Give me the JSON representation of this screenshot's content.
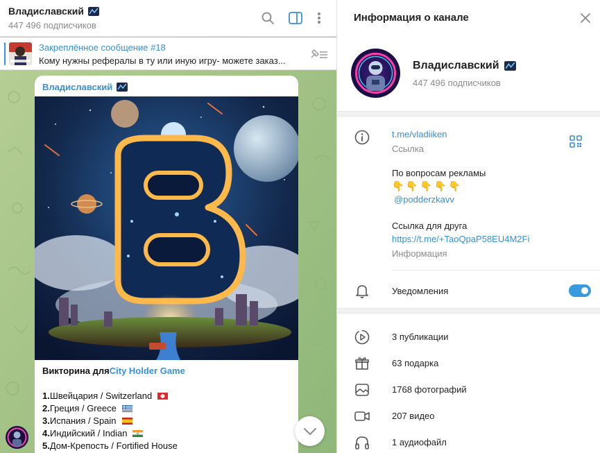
{
  "chat": {
    "title": "Владиславский",
    "subtitle": "447 496 подписчиков",
    "pinned": {
      "title": "Закреплённое сообщение #18",
      "text": "Кому нужны рефералы в ту или иную игру- можете заказ..."
    },
    "message": {
      "author": "Владиславский",
      "quiz_prefix": "Викторина для ",
      "quiz_link": "City Holder Game",
      "answers": [
        {
          "num": "1.",
          "text": " Швейцария / Switzerland",
          "flag": "switzerland"
        },
        {
          "num": "2.",
          "text": " Греция / Greece",
          "flag": "greece"
        },
        {
          "num": "3.",
          "text": "Испания / Spain",
          "flag": "spain"
        },
        {
          "num": "4.",
          "text": "Индийский / Indian",
          "flag": "india"
        },
        {
          "num": "5.",
          "text": "Дом-Крепость / Fortified House",
          "flag": ""
        }
      ]
    }
  },
  "info": {
    "title": "Информация о канале",
    "channel_name": "Владиславский",
    "subscribers": "447 496 подписчиков",
    "link": "t.me/vladiiken",
    "link_caption": "Ссылка",
    "ad_line": "По вопросам рекламы",
    "emoji_row": "👇👇👇👇👇",
    "contact": "@podderzkavv",
    "friend_link_label": "Ссылка для друга",
    "friend_link": "https://t.me/+TaoQpaP58EU4M2Fi",
    "info_caption": "Информация",
    "notifications_label": "Уведомления",
    "notifications_on": true,
    "media": [
      {
        "label": "3 публикации",
        "icon": "publications-icon"
      },
      {
        "label": "63 подарка",
        "icon": "gift-icon"
      },
      {
        "label": "1768 фотографий",
        "icon": "photo-icon"
      },
      {
        "label": "207 видео",
        "icon": "video-icon"
      },
      {
        "label": "1 аудиофайл",
        "icon": "headphones-icon"
      }
    ]
  },
  "colors": {
    "accent": "#3a8fd6",
    "toggle": "#3a9ae0",
    "chat_bg": "#a6c38a"
  }
}
